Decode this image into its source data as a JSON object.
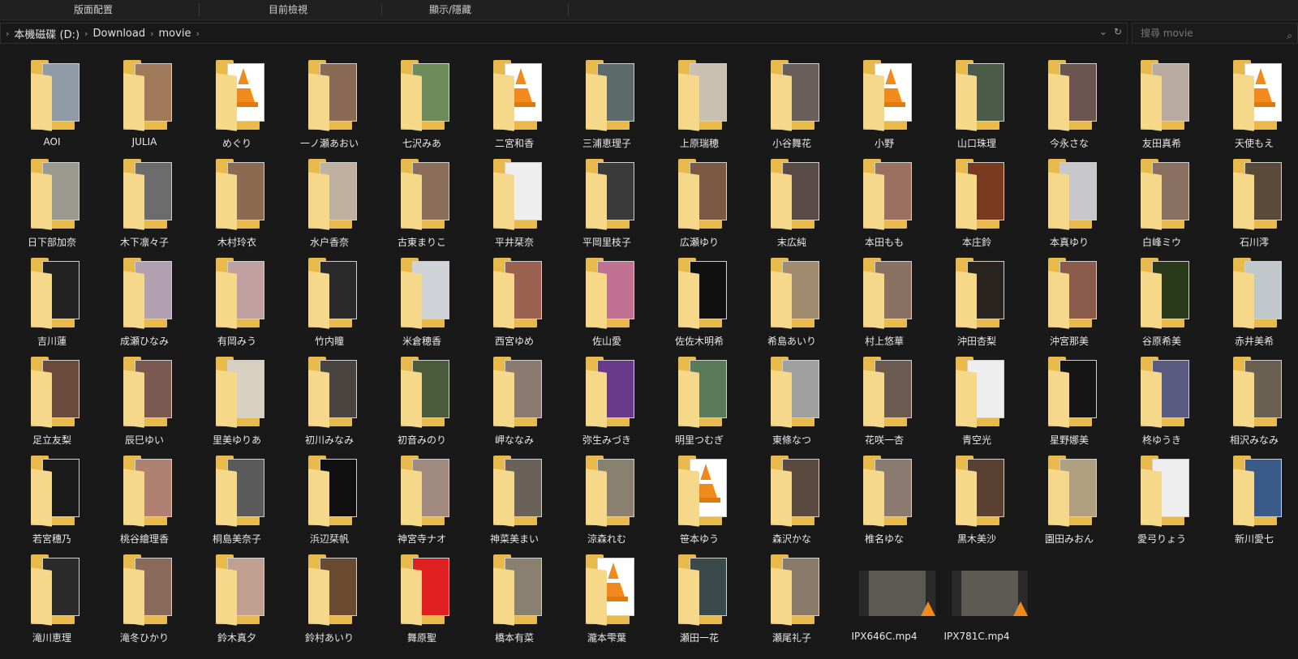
{
  "ribbon": {
    "groups": [
      "版面配置",
      "目前檢視",
      "顯示/隱藏"
    ]
  },
  "address": {
    "crumbs": [
      "本機磁碟 (D:)",
      "Download",
      "movie"
    ],
    "refresh_icon": "refresh-icon",
    "dropdown_icon": "chevron-down-icon"
  },
  "search": {
    "placeholder": "搜尋 movie",
    "icon": "search-icon"
  },
  "colors": {
    "background": "#191919",
    "folder": "#e8b94b",
    "folder_front": "#f6d88a",
    "vlc": "#f08a1c"
  },
  "folders": [
    {
      "name": "AOI",
      "thumb": "#8f9aa6",
      "cone": false
    },
    {
      "name": "JULIA",
      "thumb": "#a0785a",
      "cone": false
    },
    {
      "name": "めぐり",
      "thumb": "#ffffff",
      "cone": true
    },
    {
      "name": "一ノ瀬あおい",
      "thumb": "#8a6a55",
      "cone": false
    },
    {
      "name": "七沢みあ",
      "thumb": "#6d8a5a",
      "cone": false
    },
    {
      "name": "二宮和香",
      "thumb": "#ffffff",
      "cone": true
    },
    {
      "name": "三浦恵理子",
      "thumb": "#5d6a6a",
      "cone": false
    },
    {
      "name": "上原瑞穂",
      "thumb": "#c8c0b0",
      "cone": false
    },
    {
      "name": "小谷舞花",
      "thumb": "#6a5e5a",
      "cone": false
    },
    {
      "name": "小野",
      "thumb": "#ffffff",
      "cone": true
    },
    {
      "name": "山口珠理",
      "thumb": "#4c5a48",
      "cone": false
    },
    {
      "name": "今永さな",
      "thumb": "#6c5550",
      "cone": false
    },
    {
      "name": "友田真希",
      "thumb": "#b9aaa0",
      "cone": false
    },
    {
      "name": "天使もえ",
      "thumb": "#ffffff",
      "cone": true
    },
    {
      "name": "日下部加奈",
      "thumb": "#9a9a90",
      "cone": false
    },
    {
      "name": "木下凛々子",
      "thumb": "#6c6c6c",
      "cone": false
    },
    {
      "name": "木村玲衣",
      "thumb": "#8a6a50",
      "cone": false
    },
    {
      "name": "水户香奈",
      "thumb": "#c0b0a0",
      "cone": false
    },
    {
      "name": "古東まりこ",
      "thumb": "#8a6e5a",
      "cone": false
    },
    {
      "name": "平井栞奈",
      "thumb": "#eeeeee",
      "cone": false
    },
    {
      "name": "平岡里枝子",
      "thumb": "#3a3a3a",
      "cone": false
    },
    {
      "name": "広瀬ゆり",
      "thumb": "#7a5a44",
      "cone": false
    },
    {
      "name": "末広純",
      "thumb": "#5a4a48",
      "cone": false
    },
    {
      "name": "本田もも",
      "thumb": "#9a7060",
      "cone": false
    },
    {
      "name": "本庄鈴",
      "thumb": "#7a3a20",
      "cone": false
    },
    {
      "name": "本真ゆり",
      "thumb": "#c8c8cc",
      "cone": false
    },
    {
      "name": "白峰ミウ",
      "thumb": "#8a7060",
      "cone": false
    },
    {
      "name": "石川澪",
      "thumb": "#5a4a3a",
      "cone": false
    },
    {
      "name": "吉川蓮",
      "thumb": "#222222",
      "cone": false
    },
    {
      "name": "成瀬ひなみ",
      "thumb": "#b0a0b0",
      "cone": false
    },
    {
      "name": "有岡みう",
      "thumb": "#c0a0a0",
      "cone": false
    },
    {
      "name": "竹内瞳",
      "thumb": "#2a2a2a",
      "cone": false
    },
    {
      "name": "米倉穂香",
      "thumb": "#d0d4d8",
      "cone": false
    },
    {
      "name": "西宮ゆめ",
      "thumb": "#9a6050",
      "cone": false
    },
    {
      "name": "佐山愛",
      "thumb": "#c07090",
      "cone": false
    },
    {
      "name": "佐佐木明希",
      "thumb": "#111111",
      "cone": false
    },
    {
      "name": "希島あいり",
      "thumb": "#a08a70",
      "cone": false
    },
    {
      "name": "村上悠華",
      "thumb": "#8a7060",
      "cone": false
    },
    {
      "name": "沖田杏梨",
      "thumb": "#2a2420",
      "cone": false
    },
    {
      "name": "沖宮那美",
      "thumb": "#8a5a4a",
      "cone": false
    },
    {
      "name": "谷原希美",
      "thumb": "#2a3a1a",
      "cone": false
    },
    {
      "name": "赤井美希",
      "thumb": "#c0c8cc",
      "cone": false
    },
    {
      "name": "足立友梨",
      "thumb": "#6a4a3a",
      "cone": false
    },
    {
      "name": "辰巳ゆい",
      "thumb": "#7a5a50",
      "cone": false
    },
    {
      "name": "里美ゆりあ",
      "thumb": "#d8d0c0",
      "cone": false
    },
    {
      "name": "初川みなみ",
      "thumb": "#4a4440",
      "cone": false
    },
    {
      "name": "初音みのり",
      "thumb": "#4a5a3a",
      "cone": false
    },
    {
      "name": "岬ななみ",
      "thumb": "#8a7a70",
      "cone": false
    },
    {
      "name": "弥生みづき",
      "thumb": "#6a3a8a",
      "cone": false
    },
    {
      "name": "明里つむぎ",
      "thumb": "#5a7a5a",
      "cone": false
    },
    {
      "name": "東條なつ",
      "thumb": "#a0a0a0",
      "cone": false
    },
    {
      "name": "花咲一杏",
      "thumb": "#6a5a50",
      "cone": false
    },
    {
      "name": "青空光",
      "thumb": "#eeeeee",
      "cone": false
    },
    {
      "name": "星野娜美",
      "thumb": "#151515",
      "cone": false
    },
    {
      "name": "柊ゆうき",
      "thumb": "#5a5a80",
      "cone": false
    },
    {
      "name": "相沢みなみ",
      "thumb": "#6a6050",
      "cone": false
    },
    {
      "name": "若宮穗乃",
      "thumb": "#1a1a1a",
      "cone": false
    },
    {
      "name": "桃谷繪理香",
      "thumb": "#b08070",
      "cone": false
    },
    {
      "name": "桐島美奈子",
      "thumb": "#5a5a5a",
      "cone": false
    },
    {
      "name": "浜辺栞帆",
      "thumb": "#101010",
      "cone": false
    },
    {
      "name": "神宮寺ナオ",
      "thumb": "#a08a80",
      "cone": false
    },
    {
      "name": "神菜美まい",
      "thumb": "#6a6258",
      "cone": false
    },
    {
      "name": "涼森れむ",
      "thumb": "#8a8070",
      "cone": false
    },
    {
      "name": "笹本ゆう",
      "thumb": "#ffffff",
      "cone": true
    },
    {
      "name": "森沢かな",
      "thumb": "#5a4a40",
      "cone": false
    },
    {
      "name": "椎名ゆな",
      "thumb": "#8a7a70",
      "cone": false
    },
    {
      "name": "黒木美沙",
      "thumb": "#5a4030",
      "cone": false
    },
    {
      "name": "園田みおん",
      "thumb": "#b0a080",
      "cone": false
    },
    {
      "name": "愛弓りょう",
      "thumb": "#eeeeee",
      "cone": false
    },
    {
      "name": "新川愛七",
      "thumb": "#3a5a8a",
      "cone": false
    },
    {
      "name": "滝川恵理",
      "thumb": "#2a2a2a",
      "cone": false
    },
    {
      "name": "滝冬ひかり",
      "thumb": "#8a6a5a",
      "cone": false
    },
    {
      "name": "鈴木真夕",
      "thumb": "#c0a090",
      "cone": false
    },
    {
      "name": "鈴村あいり",
      "thumb": "#6a4a30",
      "cone": false
    },
    {
      "name": "舞原聖",
      "thumb": "#e02020",
      "cone": false
    },
    {
      "name": "橋本有菜",
      "thumb": "#8a8070",
      "cone": false
    },
    {
      "name": "瀧本雫葉",
      "thumb": "#ffffff",
      "cone": true
    },
    {
      "name": "瀬田一花",
      "thumb": "#3a4a4a",
      "cone": false
    },
    {
      "name": "瀬尾礼子",
      "thumb": "#8a7a6a",
      "cone": false
    }
  ],
  "videos": [
    {
      "name": "IPX646C.mp4",
      "icon": "vlc-icon"
    },
    {
      "name": "IPX781C.mp4",
      "icon": "vlc-icon"
    }
  ]
}
